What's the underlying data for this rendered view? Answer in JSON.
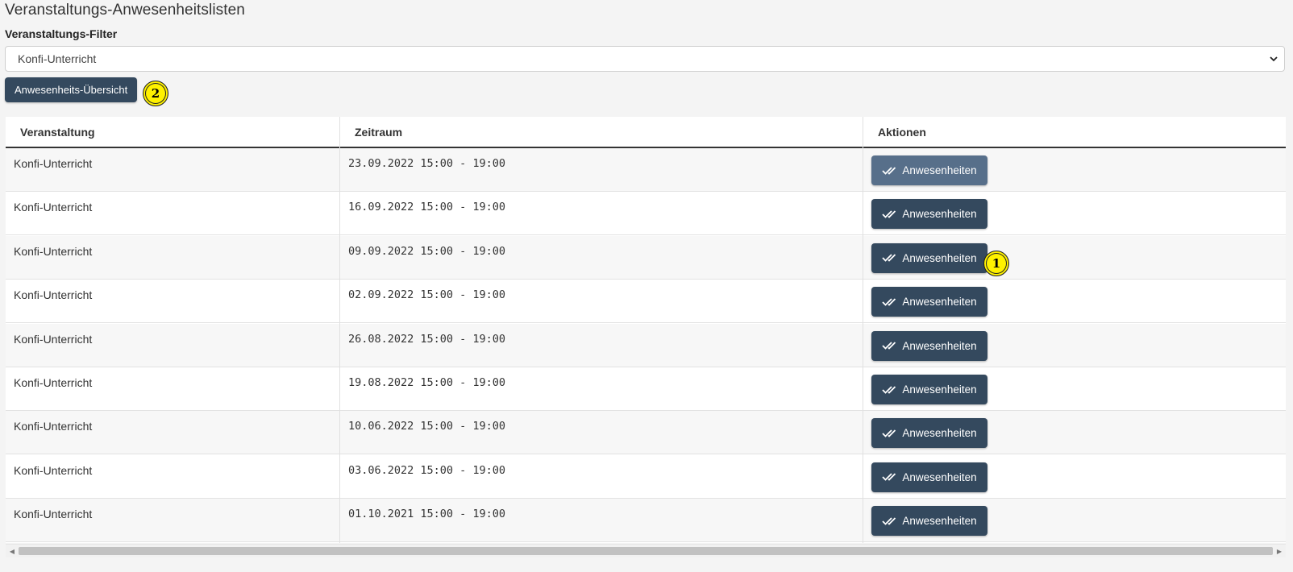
{
  "page": {
    "title": "Veranstaltungs-Anwesenheitslisten",
    "filter_label": "Veranstaltungs-Filter",
    "filter_value": "Konfi-Unterricht",
    "overview_button": "Anwesenheits-Übersicht"
  },
  "markers": [
    "1",
    "2"
  ],
  "table": {
    "headers": [
      "Veranstaltung",
      "Zeitraum",
      "Aktionen"
    ],
    "action_label": "Anwesenheiten",
    "action_icon": "double-check-icon",
    "rows": [
      {
        "name": "Konfi-Unterricht",
        "period": "23.09.2022 15:00 - 19:00"
      },
      {
        "name": "Konfi-Unterricht",
        "period": "16.09.2022 15:00 - 19:00"
      },
      {
        "name": "Konfi-Unterricht",
        "period": "09.09.2022 15:00 - 19:00"
      },
      {
        "name": "Konfi-Unterricht",
        "period": "02.09.2022 15:00 - 19:00"
      },
      {
        "name": "Konfi-Unterricht",
        "period": "26.08.2022 15:00 - 19:00"
      },
      {
        "name": "Konfi-Unterricht",
        "period": "19.08.2022 15:00 - 19:00"
      },
      {
        "name": "Konfi-Unterricht",
        "period": "10.06.2022 15:00 - 19:00"
      },
      {
        "name": "Konfi-Unterricht",
        "period": "03.06.2022 15:00 - 19:00"
      },
      {
        "name": "Konfi-Unterricht",
        "period": "01.10.2021 15:00 - 19:00"
      }
    ]
  },
  "colors": {
    "button": "#34495e",
    "button_hover": "#576f8a",
    "marker": "#fff200"
  }
}
